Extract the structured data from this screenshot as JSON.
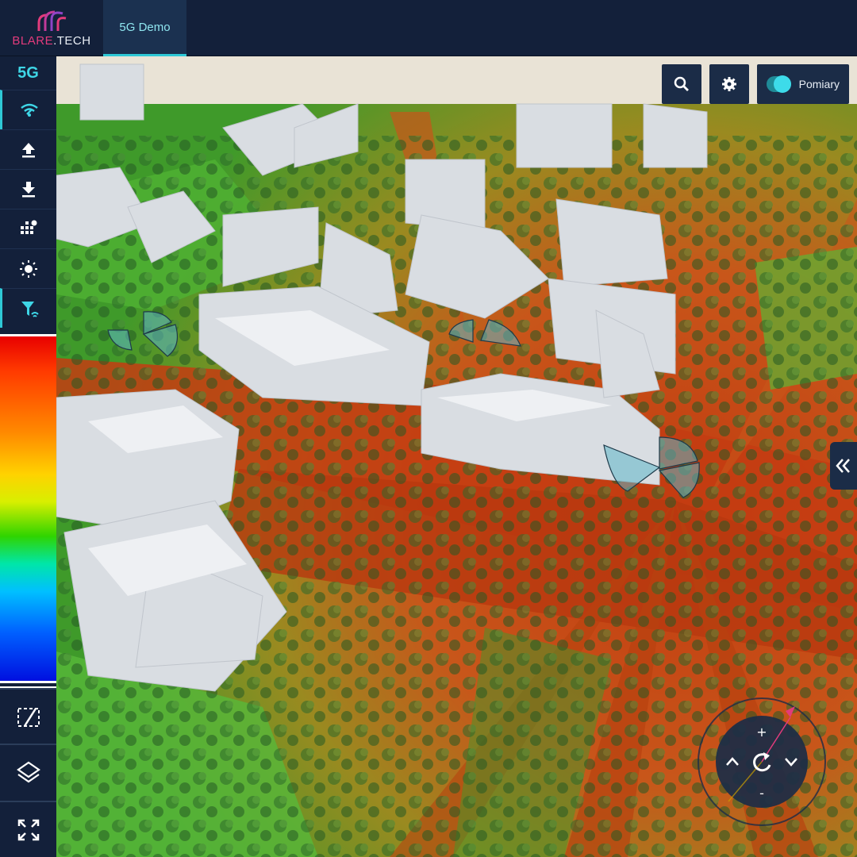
{
  "app": {
    "brand_part1": "BLARE",
    "brand_part2": ".TECH",
    "active_tab": "5G Demo"
  },
  "sidebar": {
    "tech_label": "5G",
    "items": [
      {
        "name": "signal",
        "icon": "wifi-signal-icon",
        "active": true
      },
      {
        "name": "upload",
        "icon": "upload-icon"
      },
      {
        "name": "download",
        "icon": "download-icon"
      },
      {
        "name": "grid-settings",
        "icon": "grid-dots-icon"
      },
      {
        "name": "brightness",
        "icon": "sun-icon"
      },
      {
        "name": "antenna",
        "icon": "antenna-icon"
      }
    ],
    "tools": [
      {
        "name": "measure",
        "icon": "measure-diagonal-icon"
      },
      {
        "name": "layers",
        "icon": "layers-icon"
      },
      {
        "name": "fullscreen",
        "icon": "fullscreen-icon"
      }
    ]
  },
  "legend": {
    "colors": [
      "#e80000",
      "#ff8a00",
      "#ffd200",
      "#2fd400",
      "#00c0ff",
      "#0010e0"
    ]
  },
  "toolbar": {
    "search_icon": "search-icon",
    "settings_icon": "gear-icon",
    "toggle_label": "Pomiary",
    "toggle_on": true
  },
  "compass": {
    "zoom_in": "+",
    "zoom_out": "-"
  },
  "colors": {
    "accent": "#2ec8d6",
    "panel": "#13203a",
    "brand_pink": "#e23b7c"
  }
}
